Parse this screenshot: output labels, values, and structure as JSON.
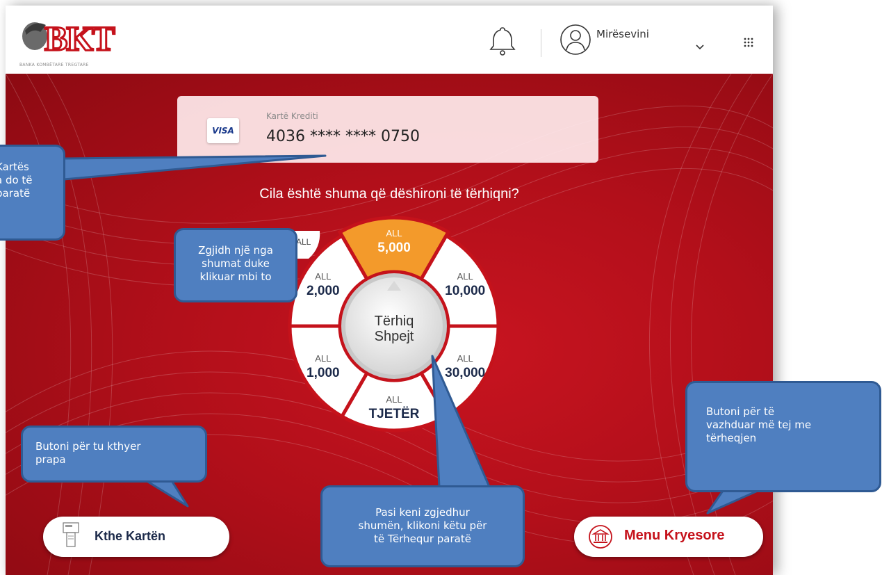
{
  "header": {
    "logo_text": "BKT",
    "logo_subtitle": "BANKA KOMBËTARE TREGTARE",
    "greeting": "Mirësevini"
  },
  "card": {
    "type_label": "Kartë Krediti",
    "brand": "VISA",
    "number": "4036 **** **** 0750"
  },
  "question": "Cila është shuma që dëshironi të tërhiqni?",
  "wheel": {
    "center_line1": "Tërhiq",
    "center_line2": "Shpejt",
    "segments": [
      {
        "currency": "ALL",
        "amount": "5,000",
        "selected": true
      },
      {
        "currency": "ALL",
        "amount": "10,000"
      },
      {
        "currency": "ALL",
        "amount": "30,000"
      },
      {
        "currency": "ALL",
        "amount": "TJETËR"
      },
      {
        "currency": "ALL",
        "amount": "1,000"
      },
      {
        "currency": "ALL",
        "amount": "2,000"
      }
    ],
    "hidden_segment_label": "ALL"
  },
  "buttons": {
    "back_label": "Kthe Kartën",
    "main_menu_label": "Menu Kryesore"
  },
  "callouts": {
    "card_info": [
      "Kartës",
      "a do të",
      "paratë"
    ],
    "choose_amount": [
      "Zgjidh një nga",
      "shumat duke",
      "klikuar mbi to"
    ],
    "continue": [
      "Butoni për të",
      "vazhduar më tej me",
      "tërheqjen"
    ],
    "back": [
      "Butoni për tu kthyer",
      "prapa"
    ],
    "withdraw": [
      "Pasi keni zgjedhur",
      "shumën, klikoni këtu për",
      "të Tërhequr paratë"
    ]
  },
  "colors": {
    "brand_red": "#c5121b",
    "selected_segment": "#f39a2b",
    "callout_blue": "#4f7fc0"
  },
  "icons": [
    "bell-icon",
    "user-icon",
    "chevron-down-icon",
    "apps-grid-icon",
    "card-return-icon",
    "bank-icon",
    "visa-icon"
  ]
}
